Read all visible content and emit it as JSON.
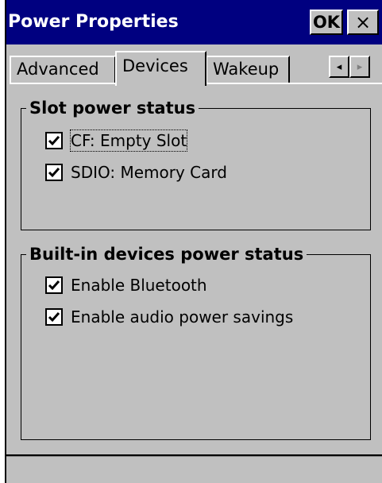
{
  "window": {
    "title": "Power Properties",
    "ok_label": "OK",
    "close_label": "×"
  },
  "tabs": [
    {
      "label": "Advanced"
    },
    {
      "label": "Devices",
      "active": true
    },
    {
      "label": "Wakeup"
    }
  ],
  "tab_scroll": {
    "left_glyph": "◂",
    "right_glyph": "▸"
  },
  "slot_power_status": {
    "title": "Slot power status",
    "items": [
      {
        "label": "CF: Empty Slot",
        "checked": true
      },
      {
        "label": "SDIO: Memory Card",
        "checked": true
      }
    ]
  },
  "builtin_devices": {
    "title": "Built-in devices power status",
    "items": [
      {
        "label": "Enable Bluetooth",
        "checked": true
      },
      {
        "label": "Enable audio power savings",
        "checked": true
      }
    ]
  },
  "colors": {
    "titlebar": "#000080",
    "face": "#c0c0c0"
  }
}
